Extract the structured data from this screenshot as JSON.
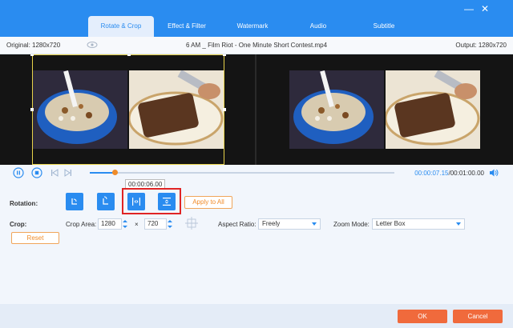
{
  "window": {
    "minimize_glyph": "—",
    "close_glyph": "✕"
  },
  "tabs": [
    {
      "label": "Rotate & Crop",
      "active": true
    },
    {
      "label": "Effect & Filter",
      "active": false
    },
    {
      "label": "Watermark",
      "active": false
    },
    {
      "label": "Audio",
      "active": false
    },
    {
      "label": "Subtitle",
      "active": false
    }
  ],
  "info": {
    "original": "Original: 1280x720",
    "filename": "6 AM _ Film Riot - One Minute Short Contest.mp4",
    "output": "Output: 1280x720"
  },
  "player": {
    "current_time": "00:00:07.15",
    "separator": "/",
    "duration": "00:01:00.00",
    "tooltip_time": "00:00:06.00",
    "progress": 0.083
  },
  "rotation": {
    "label": "Rotation:",
    "apply_all": "Apply to All",
    "buttons": [
      "rotate-left-icon",
      "rotate-right-icon",
      "flip-horizontal-icon",
      "flip-vertical-icon"
    ]
  },
  "crop": {
    "label": "Crop:",
    "area_label": "Crop Area:",
    "width": "1280",
    "times": "×",
    "height": "720",
    "aspect_label": "Aspect Ratio:",
    "aspect_value": "Freely",
    "zoom_label": "Zoom Mode:",
    "zoom_value": "Letter Box",
    "reset": "Reset"
  },
  "footer": {
    "ok": "OK",
    "cancel": "Cancel"
  },
  "colors": {
    "accent": "#2a8cf0",
    "orange": "#f08c2a",
    "highlight": "#e02424",
    "ok_bg": "#f06a3c"
  }
}
